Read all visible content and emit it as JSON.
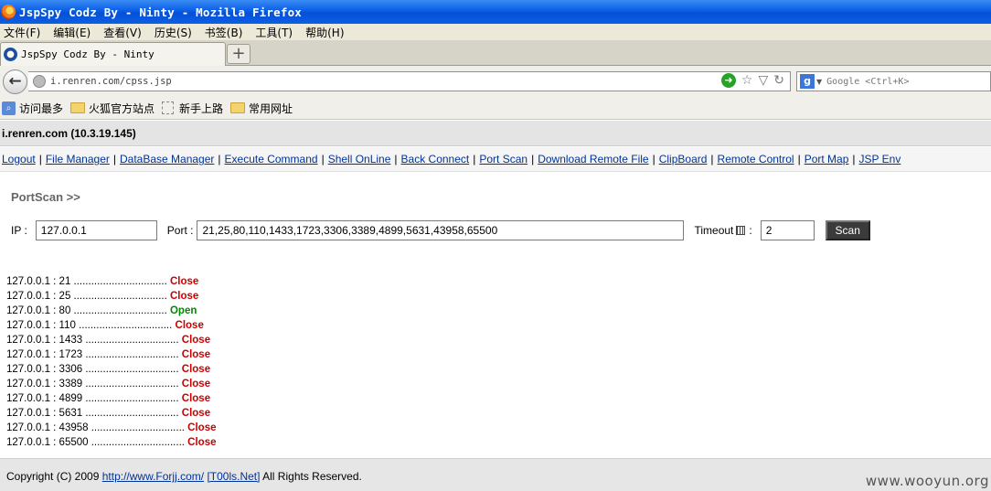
{
  "window": {
    "title": "JspSpy Codz By - Ninty - Mozilla Firefox"
  },
  "menu": [
    "文件(F)",
    "编辑(E)",
    "查看(V)",
    "历史(S)",
    "书签(B)",
    "工具(T)",
    "帮助(H)"
  ],
  "tab": {
    "label": "JspSpy Codz By - Ninty",
    "newtab": "+"
  },
  "nav": {
    "url": "i.renren.com/cpss.jsp",
    "search_placeholder": "Google <Ctrl+K>"
  },
  "bookmarks": [
    "访问最多",
    "火狐官方站点",
    "新手上路",
    "常用网址"
  ],
  "page": {
    "host": "i.renren.com (10.3.19.145)",
    "links": [
      "Logout",
      "File Manager",
      "DataBase Manager",
      "Execute Command",
      "Shell OnLine",
      "Back Connect",
      "Port Scan",
      "Download Remote File",
      "ClipBoard",
      "Remote Control",
      "Port Map",
      "JSP Env"
    ],
    "section_title": "PortScan >>",
    "form": {
      "ip_label": "IP :",
      "ip_value": "127.0.0.1",
      "port_label": "Port :",
      "port_value": "21,25,80,110,1433,1723,3306,3389,4899,5631,43958,65500",
      "timeout_label": "Timeout",
      "timeout_colon": ":",
      "timeout_value": "2",
      "scan_label": "Scan"
    },
    "results": [
      {
        "host": "127.0.0.1 : 21 ................................",
        "status": "Close"
      },
      {
        "host": "127.0.0.1 : 25 ................................",
        "status": "Close"
      },
      {
        "host": "127.0.0.1 : 80 ................................",
        "status": "Open"
      },
      {
        "host": "127.0.0.1 : 110 ................................",
        "status": "Close"
      },
      {
        "host": "127.0.0.1 : 1433 ................................",
        "status": "Close"
      },
      {
        "host": "127.0.0.1 : 1723 ................................",
        "status": "Close"
      },
      {
        "host": "127.0.0.1 : 3306 ................................",
        "status": "Close"
      },
      {
        "host": "127.0.0.1 : 3389 ................................",
        "status": "Close"
      },
      {
        "host": "127.0.0.1 : 4899 ................................",
        "status": "Close"
      },
      {
        "host": "127.0.0.1 : 5631 ................................",
        "status": "Close"
      },
      {
        "host": "127.0.0.1 : 43958 ................................",
        "status": "Close"
      },
      {
        "host": "127.0.0.1 : 65500 ................................",
        "status": "Close"
      }
    ],
    "footer": {
      "prefix": "Copyright (C) 2009",
      "link1": "http://www.Forjj.com/",
      "link2": "[T00ls.Net]",
      "suffix": "All Rights Reserved."
    }
  },
  "watermark": "www.wooyun.org"
}
